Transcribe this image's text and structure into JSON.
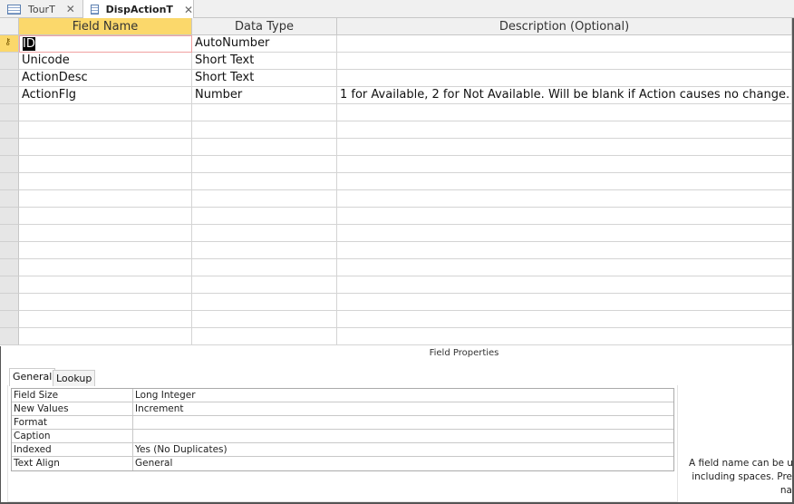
{
  "tabs": [
    {
      "label": "TourT",
      "active": false
    },
    {
      "label": "DispActionT",
      "active": true
    }
  ],
  "columns": [
    "Field Name",
    "Data Type",
    "Description (Optional)"
  ],
  "fields": [
    {
      "name": "ID",
      "type": "AutoNumber",
      "description": "",
      "primary_key": true
    },
    {
      "name": "Unicode",
      "type": "Short Text",
      "description": ""
    },
    {
      "name": "ActionDesc",
      "type": "Short Text",
      "description": ""
    },
    {
      "name": "ActionFlg",
      "type": "Number",
      "description": "1 for Available, 2 for Not Available.  Will be blank if Action causes no change."
    }
  ],
  "field_properties": {
    "title": "Field Properties",
    "tabs": [
      "General",
      "Lookup"
    ],
    "rows": [
      {
        "label": "Field Size",
        "value": "Long Integer"
      },
      {
        "label": "New Values",
        "value": "Increment"
      },
      {
        "label": "Format",
        "value": ""
      },
      {
        "label": "Caption",
        "value": ""
      },
      {
        "label": "Indexed",
        "value": "Yes (No Duplicates)"
      },
      {
        "label": "Text Align",
        "value": "General"
      }
    ],
    "help_lines": [
      "A field name can be u",
      "including spaces. Pre",
      "na"
    ]
  }
}
